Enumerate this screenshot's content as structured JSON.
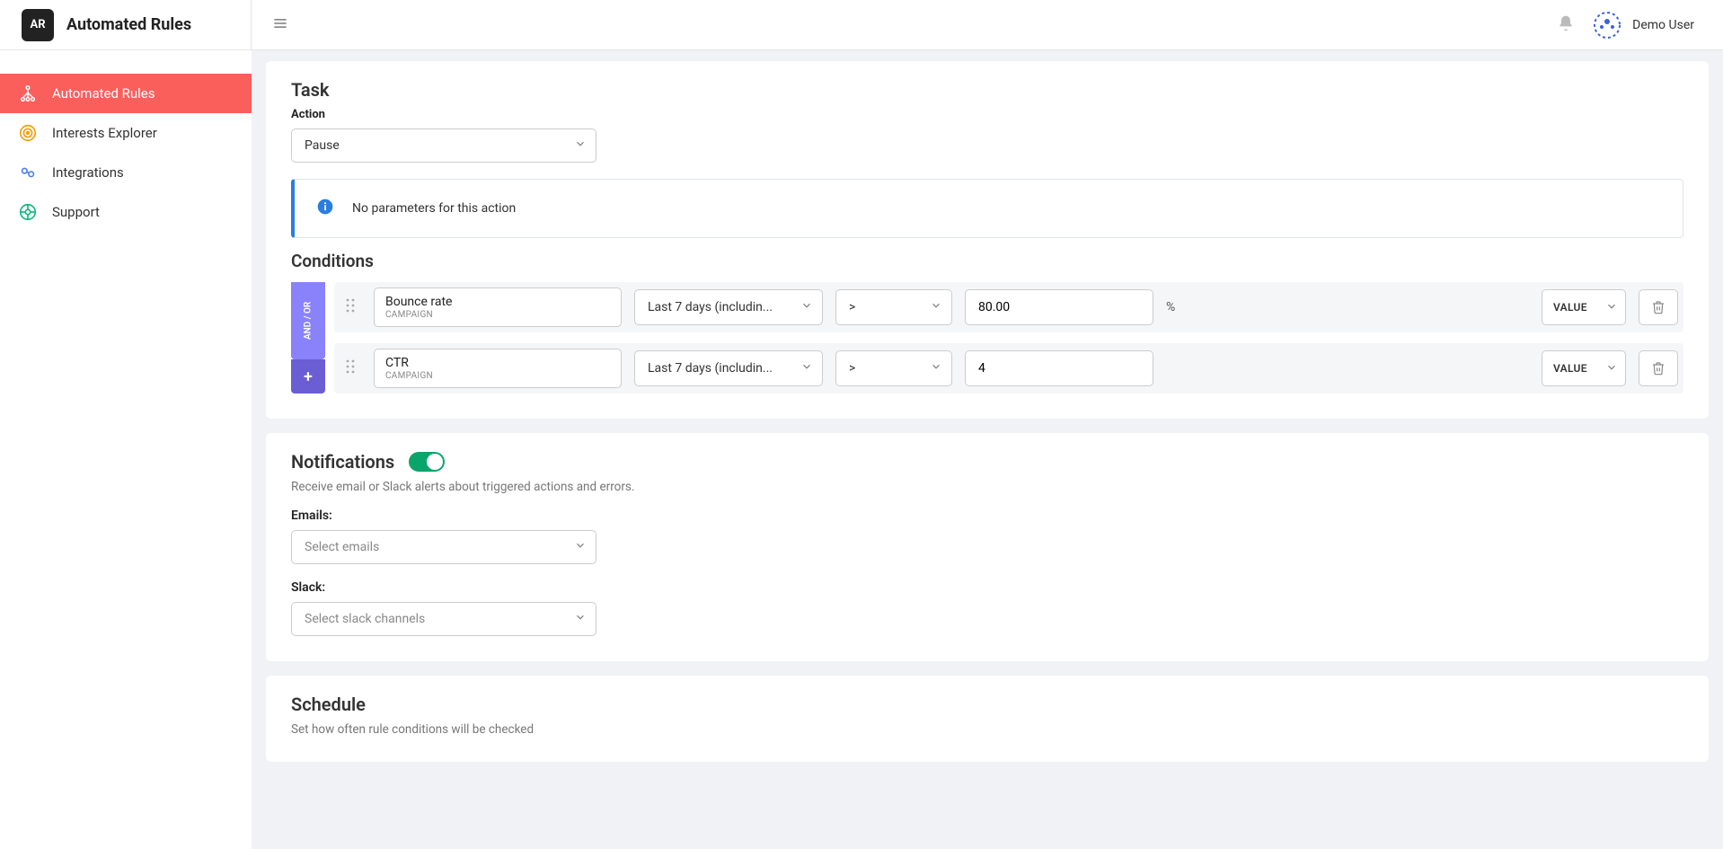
{
  "brand": {
    "badge": "AR",
    "title": "Automated Rules"
  },
  "user": {
    "name": "Demo User"
  },
  "sidebar": {
    "items": [
      {
        "label": "Automated Rules"
      },
      {
        "label": "Interests Explorer"
      },
      {
        "label": "Integrations"
      },
      {
        "label": "Support"
      }
    ]
  },
  "task": {
    "title": "Task",
    "action_label": "Action",
    "action_selected": "Pause",
    "info_text": "No parameters for this action"
  },
  "conditions": {
    "title": "Conditions",
    "andor_label": "AND / OR",
    "add_symbol": "+",
    "rows": [
      {
        "metric": "Bounce rate",
        "scope": "CAMPAIGN",
        "period": "Last 7 days (includin...",
        "operator": ">",
        "value": "80.00",
        "unit": "%",
        "value_type": "VALUE"
      },
      {
        "metric": "CTR",
        "scope": "CAMPAIGN",
        "period": "Last 7 days (includin...",
        "operator": ">",
        "value": "4",
        "unit": "",
        "value_type": "VALUE"
      }
    ]
  },
  "notifications": {
    "title": "Notifications",
    "desc": "Receive email or Slack alerts about triggered actions and errors.",
    "emails_label": "Emails:",
    "emails_placeholder": "Select emails",
    "slack_label": "Slack:",
    "slack_placeholder": "Select slack channels"
  },
  "schedule": {
    "title": "Schedule",
    "desc": "Set how often rule conditions will be checked"
  }
}
